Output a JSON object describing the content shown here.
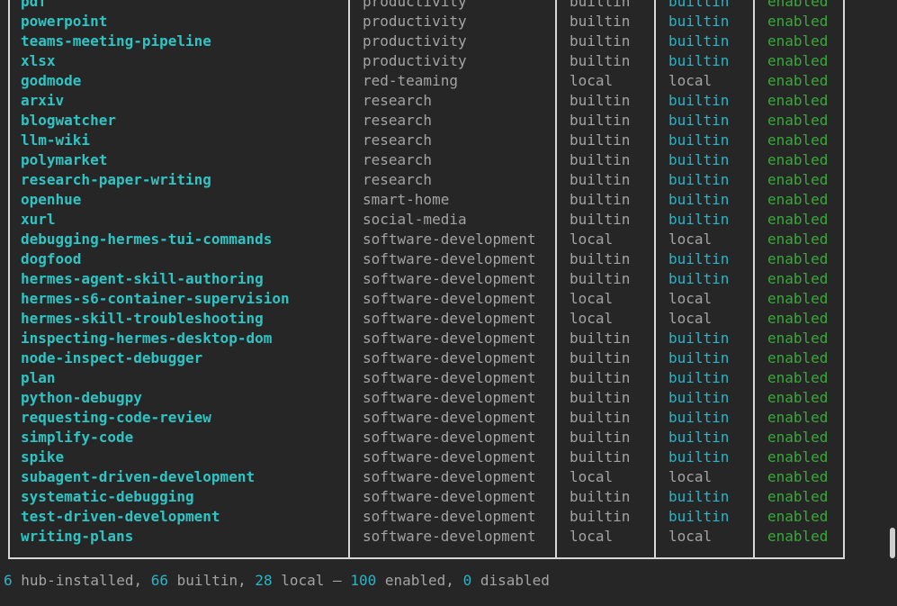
{
  "rows": [
    {
      "name": "pdf",
      "category": "productivity",
      "source": "builtin",
      "trust": "builtin",
      "status": "enabled"
    },
    {
      "name": "powerpoint",
      "category": "productivity",
      "source": "builtin",
      "trust": "builtin",
      "status": "enabled"
    },
    {
      "name": "teams-meeting-pipeline",
      "category": "productivity",
      "source": "builtin",
      "trust": "builtin",
      "status": "enabled"
    },
    {
      "name": "xlsx",
      "category": "productivity",
      "source": "builtin",
      "trust": "builtin",
      "status": "enabled"
    },
    {
      "name": "godmode",
      "category": "red-teaming",
      "source": "local",
      "trust": "local",
      "status": "enabled"
    },
    {
      "name": "arxiv",
      "category": "research",
      "source": "builtin",
      "trust": "builtin",
      "status": "enabled"
    },
    {
      "name": "blogwatcher",
      "category": "research",
      "source": "builtin",
      "trust": "builtin",
      "status": "enabled"
    },
    {
      "name": "llm-wiki",
      "category": "research",
      "source": "builtin",
      "trust": "builtin",
      "status": "enabled"
    },
    {
      "name": "polymarket",
      "category": "research",
      "source": "builtin",
      "trust": "builtin",
      "status": "enabled"
    },
    {
      "name": "research-paper-writing",
      "category": "research",
      "source": "builtin",
      "trust": "builtin",
      "status": "enabled"
    },
    {
      "name": "openhue",
      "category": "smart-home",
      "source": "builtin",
      "trust": "builtin",
      "status": "enabled"
    },
    {
      "name": "xurl",
      "category": "social-media",
      "source": "builtin",
      "trust": "builtin",
      "status": "enabled"
    },
    {
      "name": "debugging-hermes-tui-commands",
      "category": "software-development",
      "source": "local",
      "trust": "local",
      "status": "enabled"
    },
    {
      "name": "dogfood",
      "category": "software-development",
      "source": "builtin",
      "trust": "builtin",
      "status": "enabled"
    },
    {
      "name": "hermes-agent-skill-authoring",
      "category": "software-development",
      "source": "builtin",
      "trust": "builtin",
      "status": "enabled"
    },
    {
      "name": "hermes-s6-container-supervision",
      "category": "software-development",
      "source": "local",
      "trust": "local",
      "status": "enabled"
    },
    {
      "name": "hermes-skill-troubleshooting",
      "category": "software-development",
      "source": "local",
      "trust": "local",
      "status": "enabled"
    },
    {
      "name": "inspecting-hermes-desktop-dom",
      "category": "software-development",
      "source": "builtin",
      "trust": "builtin",
      "status": "enabled"
    },
    {
      "name": "node-inspect-debugger",
      "category": "software-development",
      "source": "builtin",
      "trust": "builtin",
      "status": "enabled"
    },
    {
      "name": "plan",
      "category": "software-development",
      "source": "builtin",
      "trust": "builtin",
      "status": "enabled"
    },
    {
      "name": "python-debugpy",
      "category": "software-development",
      "source": "builtin",
      "trust": "builtin",
      "status": "enabled"
    },
    {
      "name": "requesting-code-review",
      "category": "software-development",
      "source": "builtin",
      "trust": "builtin",
      "status": "enabled"
    },
    {
      "name": "simplify-code",
      "category": "software-development",
      "source": "builtin",
      "trust": "builtin",
      "status": "enabled"
    },
    {
      "name": "spike",
      "category": "software-development",
      "source": "builtin",
      "trust": "builtin",
      "status": "enabled"
    },
    {
      "name": "subagent-driven-development",
      "category": "software-development",
      "source": "local",
      "trust": "local",
      "status": "enabled"
    },
    {
      "name": "systematic-debugging",
      "category": "software-development",
      "source": "builtin",
      "trust": "builtin",
      "status": "enabled"
    },
    {
      "name": "test-driven-development",
      "category": "software-development",
      "source": "builtin",
      "trust": "builtin",
      "status": "enabled"
    },
    {
      "name": "writing-plans",
      "category": "software-development",
      "source": "local",
      "trust": "local",
      "status": "enabled"
    }
  ],
  "summary": {
    "hub_count": "6",
    "hub_label": " hub-installed, ",
    "builtin_count": "66",
    "builtin_label": " builtin, ",
    "local_count": "28",
    "local_label": " local — ",
    "enabled_count": "100",
    "enabled_label": " enabled, ",
    "disabled_count": "0",
    "disabled_label": " disabled"
  },
  "colors": {
    "background": "#262626",
    "name": "#2ec4c4",
    "builtin_trust": "#2ab4c8",
    "enabled": "#3aa83a",
    "muted": "#a3a3a3",
    "border": "#d6d6d6"
  }
}
